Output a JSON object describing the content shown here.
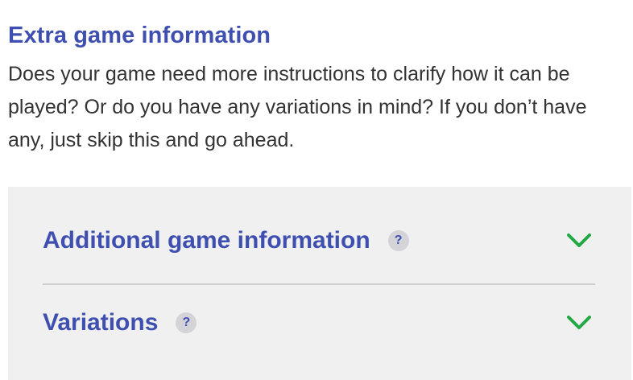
{
  "section": {
    "title": "Extra game information",
    "description": "Does your game need more instructions to clarify how it can be played? Or do you have any variations in mind? If you don’t have any, just skip this and go ahead."
  },
  "accordion": {
    "items": [
      {
        "label": "Additional game information",
        "help": "?",
        "icon": "chevron-down-icon"
      },
      {
        "label": "Variations",
        "help": "?",
        "icon": "chevron-down-icon"
      }
    ]
  },
  "colors": {
    "accent": "#3f4fb0",
    "chevron": "#22a845",
    "panel_bg": "#f0f0f0"
  }
}
